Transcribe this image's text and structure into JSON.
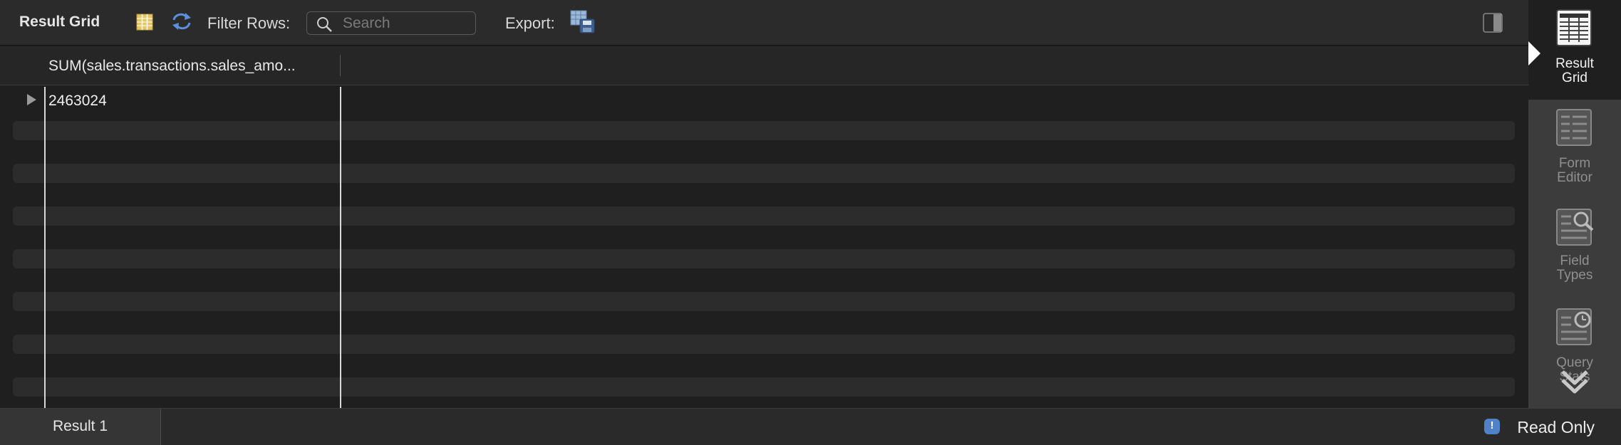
{
  "toolbar": {
    "title": "Result Grid",
    "filter_label": "Filter Rows:",
    "search_placeholder": "Search",
    "search_value": "",
    "export_label": "Export:"
  },
  "grid": {
    "columns": [
      "SUM(sales.transactions.sales_amo..."
    ],
    "rows": [
      [
        "2463024"
      ]
    ]
  },
  "sidebar": {
    "items": [
      {
        "label": "Result Grid",
        "active": true
      },
      {
        "label": "Form Editor",
        "active": false
      },
      {
        "label": "Field Types",
        "active": false
      },
      {
        "label": "Query Stats",
        "active": false
      }
    ]
  },
  "bottom": {
    "tab_label": "Result 1",
    "status_label": "Read Only"
  },
  "colors": {
    "background": "#1e1e1e",
    "toolbar": "#2b2b2b",
    "sidebar": "#3c3c3c",
    "accent": "#4f82c9"
  }
}
